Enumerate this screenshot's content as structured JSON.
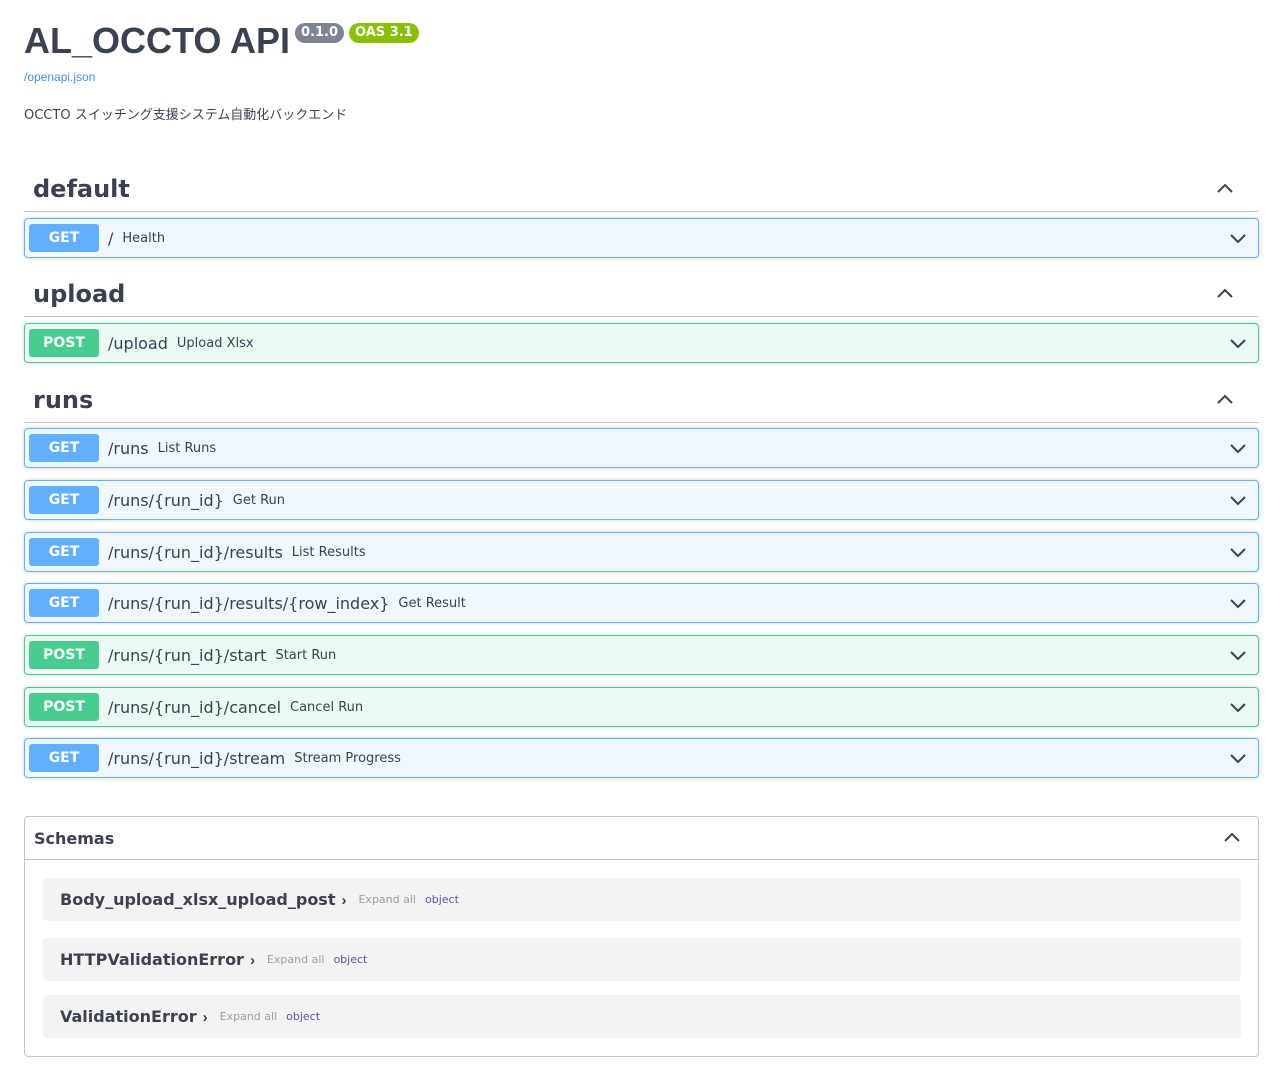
{
  "info": {
    "title": "AL_OCCTO API",
    "version": "0.1.0",
    "oas": "OAS 3.1",
    "spec_link": "/openapi.json",
    "description": "OCCTO スイッチング支援システム自動化バックエンド"
  },
  "tags": [
    {
      "name": "default",
      "operations": [
        {
          "method": "GET",
          "path": "/",
          "summary": "Health"
        }
      ]
    },
    {
      "name": "upload",
      "operations": [
        {
          "method": "POST",
          "path": "/upload",
          "summary": "Upload Xlsx"
        }
      ]
    },
    {
      "name": "runs",
      "operations": [
        {
          "method": "GET",
          "path": "/runs",
          "summary": "List Runs"
        },
        {
          "method": "GET",
          "path": "/runs/{run_id}",
          "summary": "Get Run"
        },
        {
          "method": "GET",
          "path": "/runs/{run_id}/results",
          "summary": "List Results"
        },
        {
          "method": "GET",
          "path": "/runs/{run_id}/results/{row_index}",
          "summary": "Get Result"
        },
        {
          "method": "POST",
          "path": "/runs/{run_id}/start",
          "summary": "Start Run"
        },
        {
          "method": "POST",
          "path": "/runs/{run_id}/cancel",
          "summary": "Cancel Run"
        },
        {
          "method": "GET",
          "path": "/runs/{run_id}/stream",
          "summary": "Stream Progress"
        }
      ]
    }
  ],
  "schemas": {
    "title": "Schemas",
    "models": [
      {
        "name": "Body_upload_xlsx_upload_post",
        "expand": "Expand all",
        "type": "object"
      },
      {
        "name": "HTTPValidationError",
        "expand": "Expand all",
        "type": "object"
      },
      {
        "name": "ValidationError",
        "expand": "Expand all",
        "type": "object"
      }
    ]
  },
  "colors": {
    "get": "#61affe",
    "post": "#49cc90",
    "version_badge": "#7d8492",
    "oas_badge": "#89bf04"
  }
}
